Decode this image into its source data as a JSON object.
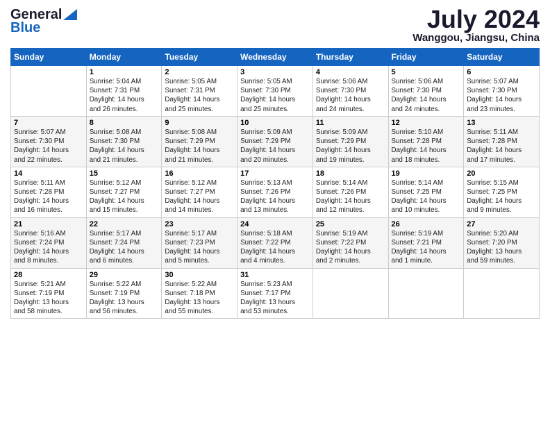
{
  "header": {
    "logo_general": "General",
    "logo_blue": "Blue",
    "month_title": "July 2024",
    "location": "Wanggou, Jiangsu, China"
  },
  "days_of_week": [
    "Sunday",
    "Monday",
    "Tuesday",
    "Wednesday",
    "Thursday",
    "Friday",
    "Saturday"
  ],
  "weeks": [
    [
      {
        "day": "",
        "info": ""
      },
      {
        "day": "1",
        "info": "Sunrise: 5:04 AM\nSunset: 7:31 PM\nDaylight: 14 hours\nand 26 minutes."
      },
      {
        "day": "2",
        "info": "Sunrise: 5:05 AM\nSunset: 7:31 PM\nDaylight: 14 hours\nand 25 minutes."
      },
      {
        "day": "3",
        "info": "Sunrise: 5:05 AM\nSunset: 7:30 PM\nDaylight: 14 hours\nand 25 minutes."
      },
      {
        "day": "4",
        "info": "Sunrise: 5:06 AM\nSunset: 7:30 PM\nDaylight: 14 hours\nand 24 minutes."
      },
      {
        "day": "5",
        "info": "Sunrise: 5:06 AM\nSunset: 7:30 PM\nDaylight: 14 hours\nand 24 minutes."
      },
      {
        "day": "6",
        "info": "Sunrise: 5:07 AM\nSunset: 7:30 PM\nDaylight: 14 hours\nand 23 minutes."
      }
    ],
    [
      {
        "day": "7",
        "info": "Sunrise: 5:07 AM\nSunset: 7:30 PM\nDaylight: 14 hours\nand 22 minutes."
      },
      {
        "day": "8",
        "info": "Sunrise: 5:08 AM\nSunset: 7:30 PM\nDaylight: 14 hours\nand 21 minutes."
      },
      {
        "day": "9",
        "info": "Sunrise: 5:08 AM\nSunset: 7:29 PM\nDaylight: 14 hours\nand 21 minutes."
      },
      {
        "day": "10",
        "info": "Sunrise: 5:09 AM\nSunset: 7:29 PM\nDaylight: 14 hours\nand 20 minutes."
      },
      {
        "day": "11",
        "info": "Sunrise: 5:09 AM\nSunset: 7:29 PM\nDaylight: 14 hours\nand 19 minutes."
      },
      {
        "day": "12",
        "info": "Sunrise: 5:10 AM\nSunset: 7:28 PM\nDaylight: 14 hours\nand 18 minutes."
      },
      {
        "day": "13",
        "info": "Sunrise: 5:11 AM\nSunset: 7:28 PM\nDaylight: 14 hours\nand 17 minutes."
      }
    ],
    [
      {
        "day": "14",
        "info": "Sunrise: 5:11 AM\nSunset: 7:28 PM\nDaylight: 14 hours\nand 16 minutes."
      },
      {
        "day": "15",
        "info": "Sunrise: 5:12 AM\nSunset: 7:27 PM\nDaylight: 14 hours\nand 15 minutes."
      },
      {
        "day": "16",
        "info": "Sunrise: 5:12 AM\nSunset: 7:27 PM\nDaylight: 14 hours\nand 14 minutes."
      },
      {
        "day": "17",
        "info": "Sunrise: 5:13 AM\nSunset: 7:26 PM\nDaylight: 14 hours\nand 13 minutes."
      },
      {
        "day": "18",
        "info": "Sunrise: 5:14 AM\nSunset: 7:26 PM\nDaylight: 14 hours\nand 12 minutes."
      },
      {
        "day": "19",
        "info": "Sunrise: 5:14 AM\nSunset: 7:25 PM\nDaylight: 14 hours\nand 10 minutes."
      },
      {
        "day": "20",
        "info": "Sunrise: 5:15 AM\nSunset: 7:25 PM\nDaylight: 14 hours\nand 9 minutes."
      }
    ],
    [
      {
        "day": "21",
        "info": "Sunrise: 5:16 AM\nSunset: 7:24 PM\nDaylight: 14 hours\nand 8 minutes."
      },
      {
        "day": "22",
        "info": "Sunrise: 5:17 AM\nSunset: 7:24 PM\nDaylight: 14 hours\nand 6 minutes."
      },
      {
        "day": "23",
        "info": "Sunrise: 5:17 AM\nSunset: 7:23 PM\nDaylight: 14 hours\nand 5 minutes."
      },
      {
        "day": "24",
        "info": "Sunrise: 5:18 AM\nSunset: 7:22 PM\nDaylight: 14 hours\nand 4 minutes."
      },
      {
        "day": "25",
        "info": "Sunrise: 5:19 AM\nSunset: 7:22 PM\nDaylight: 14 hours\nand 2 minutes."
      },
      {
        "day": "26",
        "info": "Sunrise: 5:19 AM\nSunset: 7:21 PM\nDaylight: 14 hours\nand 1 minute."
      },
      {
        "day": "27",
        "info": "Sunrise: 5:20 AM\nSunset: 7:20 PM\nDaylight: 13 hours\nand 59 minutes."
      }
    ],
    [
      {
        "day": "28",
        "info": "Sunrise: 5:21 AM\nSunset: 7:19 PM\nDaylight: 13 hours\nand 58 minutes."
      },
      {
        "day": "29",
        "info": "Sunrise: 5:22 AM\nSunset: 7:19 PM\nDaylight: 13 hours\nand 56 minutes."
      },
      {
        "day": "30",
        "info": "Sunrise: 5:22 AM\nSunset: 7:18 PM\nDaylight: 13 hours\nand 55 minutes."
      },
      {
        "day": "31",
        "info": "Sunrise: 5:23 AM\nSunset: 7:17 PM\nDaylight: 13 hours\nand 53 minutes."
      },
      {
        "day": "",
        "info": ""
      },
      {
        "day": "",
        "info": ""
      },
      {
        "day": "",
        "info": ""
      }
    ]
  ]
}
